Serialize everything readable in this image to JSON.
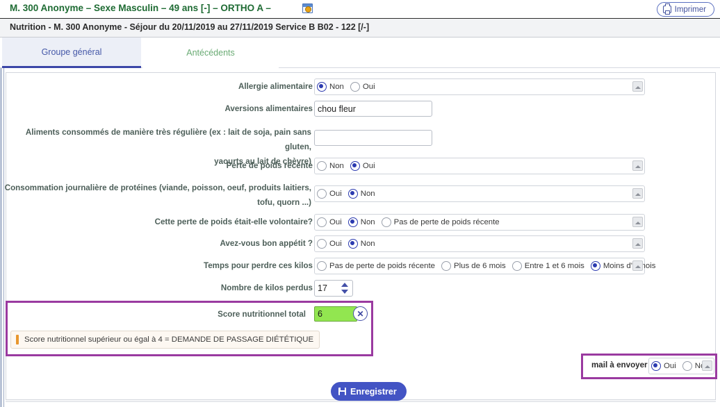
{
  "header": {
    "patient_title": "M. 300 Anonyme – Sexe Masculin – 49 ans [-] – ORTHO A –",
    "app_icon": "window-gear-icon",
    "print_label": "Imprimer",
    "print_icon": "printer-icon",
    "subtitle": "Nutrition - M. 300 Anonyme - Séjour du 20/11/2019 au 27/11/2019 Service B B02 - 122 [/-]"
  },
  "tabs": [
    {
      "label": "Groupe général",
      "active": true
    },
    {
      "label": "Antécédents",
      "active": false
    }
  ],
  "form": {
    "rows": [
      {
        "label": "Allergie alimentaire",
        "type": "radio",
        "options": [
          "Non",
          "Oui"
        ],
        "selected": "Non"
      },
      {
        "label": "Aversions alimentaires",
        "type": "text",
        "value": "chou fleur",
        "placeholder": ""
      },
      {
        "label_line1": "Aliments consommés de manière très régulière (ex : lait de soja, pain sans gluten,",
        "label_line2": "yaourts au lait de chèvre)",
        "type": "text",
        "value": "",
        "placeholder": ""
      },
      {
        "label": "Perte de poids récente",
        "type": "radio",
        "options": [
          "Non",
          "Oui"
        ],
        "selected": "Oui"
      },
      {
        "label_line1": "Consommation journalière de protéines (viande, poisson, oeuf, produits laitiers,",
        "label_line2": "tofu, quorn ...)",
        "type": "radio",
        "options": [
          "Oui",
          "Non"
        ],
        "selected": "Non"
      },
      {
        "label": "Cette perte de poids était-elle volontaire?",
        "type": "radio",
        "options": [
          "Oui",
          "Non",
          "Pas de perte de poids récente"
        ],
        "selected": "Non"
      },
      {
        "label": "Avez-vous bon appétit ?",
        "type": "radio",
        "options": [
          "Oui",
          "Non"
        ],
        "selected": "Non"
      },
      {
        "label": "Temps pour perdre ces kilos",
        "type": "radio",
        "options": [
          "Pas de perte de poids récente",
          "Plus de 6 mois",
          "Entre 1 et 6 mois",
          "Moins d'1 mois"
        ],
        "selected": "Moins d'1 mois"
      },
      {
        "label": "Nombre de kilos perdus",
        "type": "spinner",
        "value": "17"
      }
    ]
  },
  "score_section": {
    "label": "Score nutritionnel total",
    "value": "6",
    "clear_icon": "✕",
    "warning_icon": "exclamation-icon",
    "warning_text": "Score nutritionnel supérieur ou égal à 4 = DEMANDE DE PASSAGE DIÉTÉTIQUE",
    "highlight_color": "#9a3aa0",
    "value_bg_color": "#92e650"
  },
  "mail_section": {
    "label": "mail à envoyer",
    "options": [
      "Oui",
      "Non"
    ],
    "selected": "Oui",
    "highlight_color": "#9a3aa0"
  },
  "footer": {
    "save_label": "Enregistrer",
    "save_icon": "floppy-disk-icon"
  }
}
